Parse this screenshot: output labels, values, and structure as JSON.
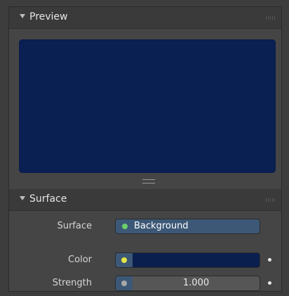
{
  "preview_panel": {
    "title": "Preview",
    "preview_color": "#0a1f52"
  },
  "surface_panel": {
    "title": "Surface",
    "surface": {
      "label": "Surface",
      "value": "Background",
      "socket_color": "#6ccf6a"
    },
    "color": {
      "label": "Color",
      "value_color": "#0b1f4e",
      "socket_color": "#e7e541"
    },
    "strength": {
      "label": "Strength",
      "value": "1.000",
      "socket_color": "#a8a8a8"
    }
  }
}
